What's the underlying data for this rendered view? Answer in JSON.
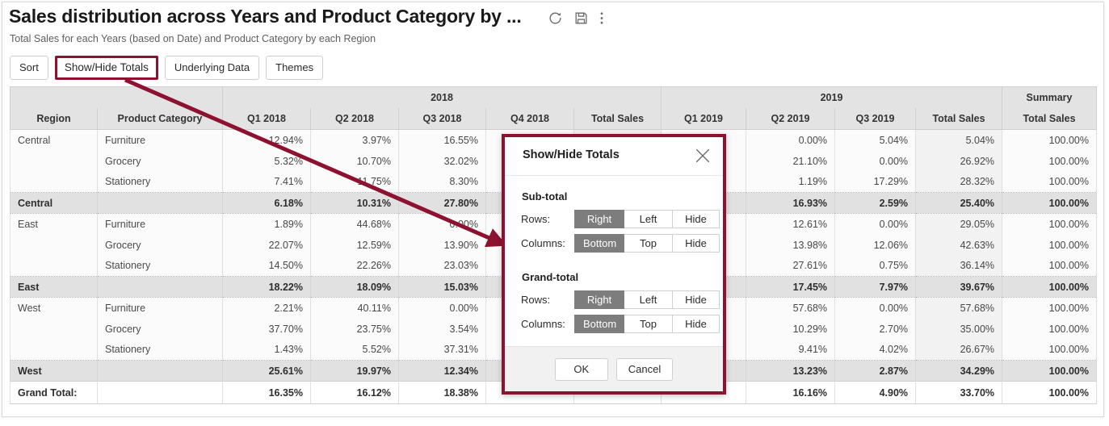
{
  "header": {
    "title": "Sales distribution across Years and Product Category by ...",
    "subtitle": "Total Sales for each Years (based on Date) and Product Category by each Region",
    "icons": [
      "refresh-icon",
      "save-icon",
      "more-options-icon"
    ]
  },
  "toolbar": {
    "sort_label": "Sort",
    "show_hide_totals_label": "Show/Hide Totals",
    "underlying_data_label": "Underlying Data",
    "themes_label": "Themes"
  },
  "table": {
    "group_headers": [
      {
        "label": "",
        "span": 2
      },
      {
        "label": "2018",
        "span": 5
      },
      {
        "label": "2019",
        "span": 4
      },
      {
        "label": "Summary",
        "span": 1
      }
    ],
    "columns": [
      "Region",
      "Product Category",
      "Q1 2018",
      "Q2 2018",
      "Q3 2018",
      "Q4 2018",
      "Total Sales",
      "Q1 2019",
      "Q2 2019",
      "Q3 2019",
      "Total Sales",
      "Total Sales"
    ],
    "rows": [
      {
        "kind": "data",
        "first": true,
        "region": "Central",
        "category": "Furniture",
        "cells": [
          "12.94%",
          "3.97%",
          "16.55%",
          "",
          "",
          "",
          "0.00%",
          "5.04%",
          "5.04%",
          "100.00%"
        ]
      },
      {
        "kind": "data",
        "first": false,
        "region": "",
        "category": "Grocery",
        "cells": [
          "5.32%",
          "10.70%",
          "32.02%",
          "",
          "",
          "",
          "21.10%",
          "0.00%",
          "26.92%",
          "100.00%"
        ]
      },
      {
        "kind": "data",
        "first": false,
        "region": "",
        "category": "Stationery",
        "cells": [
          "7.41%",
          "11.75%",
          "8.30%",
          "",
          "",
          "",
          "1.19%",
          "17.29%",
          "28.32%",
          "100.00%"
        ]
      },
      {
        "kind": "subtotal",
        "region": "Central",
        "category": "",
        "cells": [
          "6.18%",
          "10.31%",
          "27.80%",
          "",
          "",
          "",
          "16.93%",
          "2.59%",
          "25.40%",
          "100.00%"
        ]
      },
      {
        "kind": "data",
        "first": true,
        "region": "East",
        "category": "Furniture",
        "cells": [
          "1.89%",
          "44.68%",
          "0.00%",
          "",
          "",
          "",
          "12.61%",
          "0.00%",
          "29.05%",
          "100.00%"
        ]
      },
      {
        "kind": "data",
        "first": false,
        "region": "",
        "category": "Grocery",
        "cells": [
          "22.07%",
          "12.59%",
          "13.90%",
          "",
          "",
          "",
          "13.98%",
          "12.06%",
          "42.63%",
          "100.00%"
        ]
      },
      {
        "kind": "data",
        "first": false,
        "region": "",
        "category": "Stationery",
        "cells": [
          "14.50%",
          "22.26%",
          "23.03%",
          "",
          "",
          "",
          "27.61%",
          "0.75%",
          "36.14%",
          "100.00%"
        ]
      },
      {
        "kind": "subtotal",
        "region": "East",
        "category": "",
        "cells": [
          "18.22%",
          "18.09%",
          "15.03%",
          "",
          "",
          "",
          "17.45%",
          "7.97%",
          "39.67%",
          "100.00%"
        ]
      },
      {
        "kind": "data",
        "first": true,
        "region": "West",
        "category": "Furniture",
        "cells": [
          "2.21%",
          "40.11%",
          "0.00%",
          "",
          "",
          "",
          "57.68%",
          "0.00%",
          "57.68%",
          "100.00%"
        ]
      },
      {
        "kind": "data",
        "first": false,
        "region": "",
        "category": "Grocery",
        "cells": [
          "37.70%",
          "23.75%",
          "3.54%",
          "",
          "",
          "",
          "10.29%",
          "2.70%",
          "35.00%",
          "100.00%"
        ]
      },
      {
        "kind": "data",
        "first": false,
        "region": "",
        "category": "Stationery",
        "cells": [
          "1.43%",
          "5.52%",
          "37.31%",
          "",
          "",
          "",
          "9.41%",
          "4.02%",
          "26.67%",
          "100.00%"
        ]
      },
      {
        "kind": "subtotal",
        "region": "West",
        "category": "",
        "cells": [
          "25.61%",
          "19.97%",
          "12.34%",
          "",
          "",
          "",
          "13.23%",
          "2.87%",
          "34.29%",
          "100.00%"
        ]
      },
      {
        "kind": "grandtotal",
        "region": "Grand Total:",
        "category": "",
        "cells": [
          "16.35%",
          "16.12%",
          "18.38%",
          "",
          "",
          "",
          "16.16%",
          "4.90%",
          "33.70%",
          "100.00%"
        ]
      }
    ]
  },
  "dialog": {
    "title": "Show/Hide Totals",
    "close_icon": "close-icon",
    "subtotal": {
      "section_label": "Sub-total",
      "rows_label": "Rows:",
      "rows_options": [
        "Right",
        "Left",
        "Hide"
      ],
      "rows_selected": "Right",
      "columns_label": "Columns:",
      "columns_options": [
        "Bottom",
        "Top",
        "Hide"
      ],
      "columns_selected": "Bottom"
    },
    "grandtotal": {
      "section_label": "Grand-total",
      "rows_label": "Rows:",
      "rows_options": [
        "Right",
        "Left",
        "Hide"
      ],
      "rows_selected": "Right",
      "columns_label": "Columns:",
      "columns_options": [
        "Bottom",
        "Top",
        "Hide"
      ],
      "columns_selected": "Bottom"
    },
    "ok_label": "OK",
    "cancel_label": "Cancel"
  },
  "annotation": {
    "color": "#8c1230",
    "description": "arrow-from-show-hide-totals-button-to-dialog"
  }
}
